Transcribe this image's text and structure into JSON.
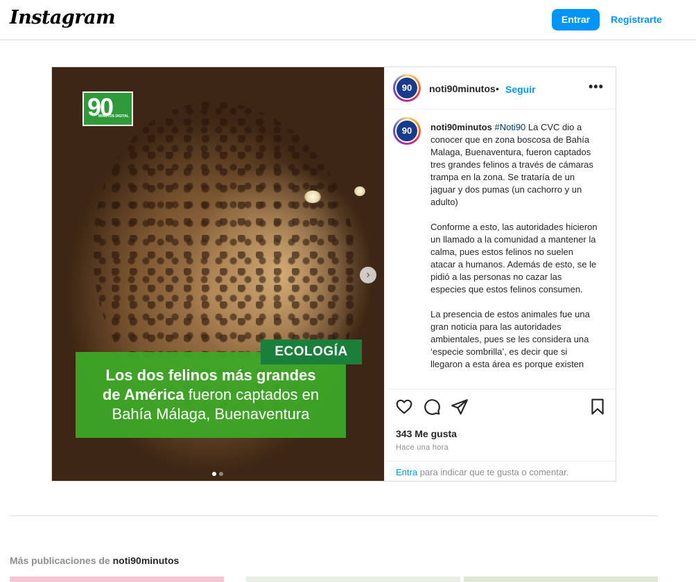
{
  "header": {
    "logo_text": "Instagram",
    "login_label": "Entrar",
    "signup_label": "Registrarte"
  },
  "post": {
    "media": {
      "badge_number": "90",
      "badge_sub": "MINUTOS DIGITAL",
      "category_tag": "ECOLOGÍA",
      "headline_bold": "Los dos felinos más grandes",
      "headline_line2_bold": "de América",
      "headline_line2_rest": " fueron captados en",
      "headline_line3": "Bahía Málaga, Buenaventura",
      "next_arrow": "›",
      "carousel_total": 2,
      "carousel_active": 1
    },
    "author": {
      "avatar_text": "90",
      "username": "noti90minutos",
      "separator": "•",
      "follow_label": "Seguir",
      "more_label": "•••"
    },
    "caption": {
      "avatar_text": "90",
      "username": "noti90minutos",
      "hashtag": "#Noti90",
      "paragraph1": " La CVC dio a conocer que en zona boscosa de Bahía Malaga, Buenaventura, fueron captados tres grandes felinos a través de cámaras trampa en la zona. Se trataría de un jaguar y dos pumas (un cachorro y un adulto)",
      "paragraph2": "Conforme a esto, las autoridades hicieron un llamado a la comunidad a mantener la calma, pues estos felinos no suelen atacar a humanos. Además de esto, se le pidió a las personas no cazar las especies que estos felinos consumen.",
      "paragraph3": "La presencia de estos animales fue una gran noticia para las autoridades ambientales, pues se les considera una ‘especie sombrilla’, es decir que si llegaron a esta área es porque existen"
    },
    "actions": {
      "likes": "343 Me gusta",
      "time": "Hace una hora",
      "login_link": "Entra",
      "login_rest": " para indicar que te gusta o comentar.",
      "icons": [
        "heart-icon",
        "comment-icon",
        "share-icon",
        "bookmark-icon"
      ]
    }
  },
  "more_section": {
    "prefix": "Más publicaciones de ",
    "username": "noti90minutos"
  },
  "colors": {
    "accent": "#0095f6",
    "badge_green": "#2e9a3a",
    "headline_green": "#3caa28",
    "tag_green": "#1a7f3a"
  }
}
